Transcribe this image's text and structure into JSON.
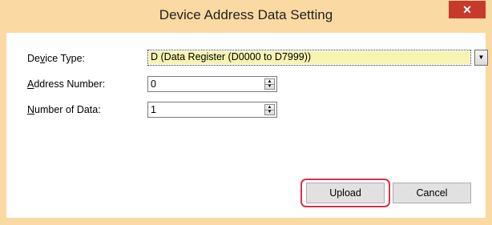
{
  "window": {
    "title": "Device Address Data Setting",
    "close_label": "✕"
  },
  "form": {
    "device_type": {
      "label_pre": "De",
      "label_accel": "v",
      "label_post": "ice Type:",
      "value": "D (Data Register (D0000 to D7999))"
    },
    "address_number": {
      "label_accel": "A",
      "label_post": "ddress Number:",
      "value": "0"
    },
    "number_of_data": {
      "label_accel": "N",
      "label_post": "umber of Data:",
      "value": "1"
    }
  },
  "buttons": {
    "upload": "Upload",
    "cancel": "Cancel"
  },
  "colors": {
    "titlebar": "#fbd9a2",
    "close": "#c7392b",
    "combo_highlight": "#f7f3b1",
    "callout": "#d6334a"
  }
}
